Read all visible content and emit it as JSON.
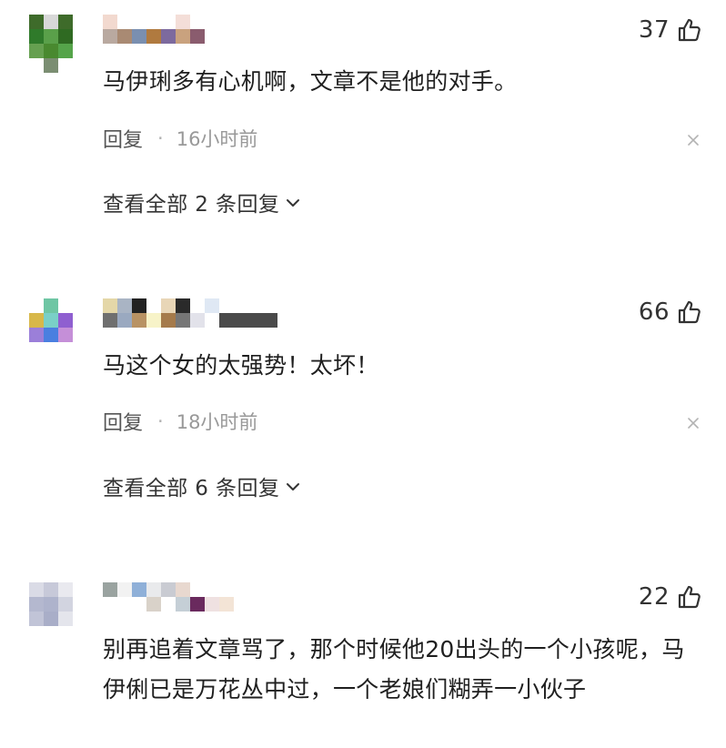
{
  "comments": [
    {
      "likes": "37",
      "text": "马伊琍多有心机啊，文章不是他的对手。",
      "reply_label": "回复",
      "separator": "·",
      "time": "16小时前",
      "view_all": "查看全部 2 条回复",
      "avatar_colors": [
        "#3e6b2a",
        "#d8d8d8",
        "#3e6b2a",
        "#2f7a2a",
        "#5aa04a",
        "#2f6a22",
        "#66a050",
        "#49892f",
        "#55a44a"
      ],
      "avatar_tail": "#7b8e72",
      "nick_colors": [
        "#f2d9cf",
        "#ffffff",
        "#ffffff",
        "#ffffff",
        "#ffffff",
        "#f4ded8",
        "#ffffff",
        "#b9a9a0",
        "#a98a73",
        "#7a8fb0",
        "#b07a3f",
        "#7d6a9e",
        "#c9a27e",
        "#8a5c6e"
      ]
    },
    {
      "likes": "66",
      "text": "马这个女的太强势！太坏！",
      "reply_label": "回复",
      "separator": "·",
      "time": "18小时前",
      "view_all": "查看全部 6 条回复",
      "avatar_colors": [
        "#ffffff",
        "#6fc6a4",
        "#ffffff",
        "#d8b84a",
        "#7ad0c7",
        "#8f5fd0",
        "#9b7fd9",
        "#4a7fe0",
        "#c58fd8"
      ],
      "nick_colors": [
        "#e4d7a8",
        "#a9b4c4",
        "#222222",
        "#ffffff",
        "#e8d6b7",
        "#2a2a2a",
        "#ffffff",
        "#dfe8f4",
        "#ffffff",
        "#ffffff",
        "#ffffff",
        "#ffffff",
        "#6f6f6f",
        "#9aa9c0",
        "#b89263",
        "#f7f3c8",
        "#a57a4a",
        "#767676",
        "#e2e2ea",
        "#ffffff",
        "#4a4a4a",
        "#4a4a4a",
        "#4a4a4a",
        "#4a4a4a"
      ]
    },
    {
      "likes": "22",
      "text": "别再追着文章骂了，那个时候他20出头的一个小孩呢，马伊俐已是万花丛中过，一个老娘们糊弄一小伙子",
      "avatar_colors": [
        "#dadbe6",
        "#c7c9d9",
        "#e9e9ef",
        "#b4b8cf",
        "#aeb3cc",
        "#d2d4e0",
        "#c1c4d7",
        "#a9aec8",
        "#e4e5ec"
      ],
      "nick_colors": [
        "#9aa3a0",
        "#f2f2f2",
        "#8fb0d8",
        "#e9eaec",
        "#c9cbd2",
        "#e8d8cf",
        "#ffffff",
        "#ffffff",
        "#ffffff",
        "#ffffff",
        "#ffffff",
        "#ffffff",
        "#d9d2c9",
        "#ffffff",
        "#c5cfd6",
        "#6a2a5e",
        "#efe1e1",
        "#f3e4d6"
      ]
    }
  ],
  "colors": {
    "text": "#1f1f1f",
    "meta": "#999999",
    "count": "#333333"
  },
  "icons": {
    "like": "thumbs-up-icon",
    "close": "close-icon",
    "expand": "chevron-down-icon"
  }
}
